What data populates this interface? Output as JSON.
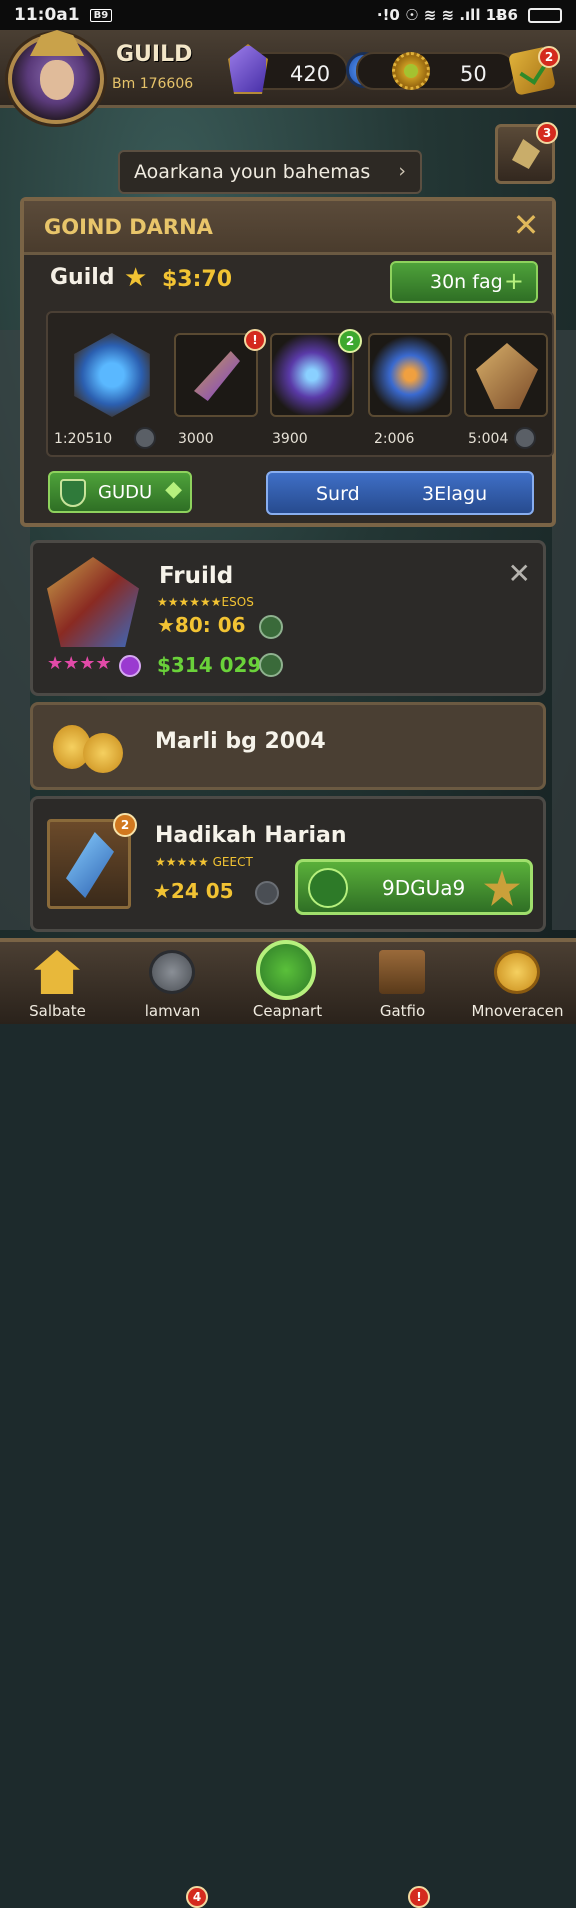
{
  "status": {
    "time": "11:0a1",
    "badge": "B9",
    "indicators": "·!0 ☉ ≋ ≋ .ıll 1Ƀ6"
  },
  "header": {
    "title": "GUILD",
    "subtitle": "Bm 176606",
    "res1": "420",
    "res2": "50"
  },
  "banner": {
    "text": "Aoarkana youn bahemas",
    "chevron": "›"
  },
  "badges": {
    "mail": "2",
    "side": "3",
    "item1": "!",
    "item2": "2",
    "card3": "2",
    "nav1": "4",
    "nav3": "!"
  },
  "panel": {
    "title": "GOIND DARNA",
    "guild_label": "Guild",
    "gold": "$3:70",
    "green_btn": "30n fag",
    "items": [
      {
        "value": "1:20510"
      },
      {
        "value": "3000"
      },
      {
        "value": "3900"
      },
      {
        "value": "2:006"
      },
      {
        "value": "5:004"
      }
    ],
    "guild_btn": "GUDU",
    "blue_btn_left": "Surd",
    "blue_btn_right": "3Elagu"
  },
  "card1": {
    "name": "Fruild",
    "stars_text": "★★★★★★ESOS",
    "row1": "★80: 06",
    "row2": "$314 029",
    "pink_stars": "★★★★"
  },
  "card2": {
    "text": "Marli bg 2004"
  },
  "card3": {
    "name": "Hadikah Harian",
    "stars_text": "★★★★★ GEECT",
    "row": "★24 05",
    "btn": "9DGUa9"
  },
  "nav": [
    {
      "label": "Salbate",
      "icon": "home-icon"
    },
    {
      "label": "lamvan",
      "icon": "compass-icon"
    },
    {
      "label": "Ceapnart",
      "icon": "sword-icon"
    },
    {
      "label": "Gatfio",
      "icon": "book-icon"
    },
    {
      "label": "Mnoveracen",
      "icon": "coin-icon"
    }
  ]
}
